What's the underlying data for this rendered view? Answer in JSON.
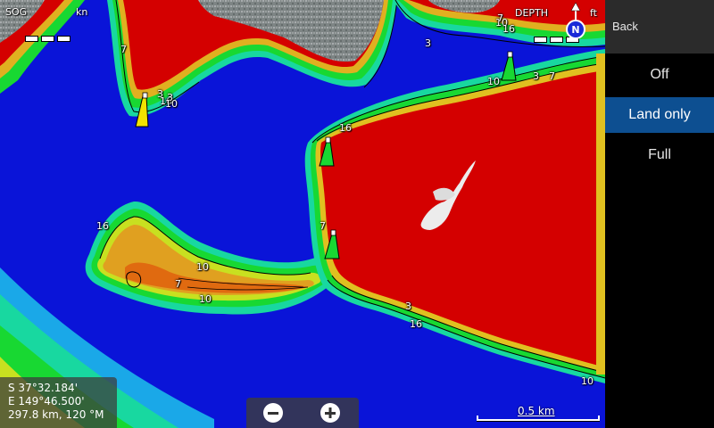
{
  "hud": {
    "sog_label": "SOG",
    "sog_unit": "kn",
    "depth_label": "DEPTH",
    "depth_unit": "ft",
    "north_label": "N"
  },
  "coordinates": {
    "lat": "S  37°32.184'",
    "lon": "E 149°46.500'",
    "range_bearing": "297.8 km, 120 °M"
  },
  "zoom": {
    "out_icon": "minus-icon",
    "in_icon": "plus-icon"
  },
  "scale": {
    "label": "0.5 km"
  },
  "depth_labels": [
    "7",
    "3",
    "16",
    "3",
    "10",
    "3",
    "7",
    "10",
    "16",
    "7",
    "3",
    "10",
    "16",
    "16",
    "7",
    "10",
    "7",
    "10",
    "3",
    "16",
    "10"
  ],
  "menu": {
    "back_label": "Back",
    "options": [
      {
        "label": "Off",
        "selected": false
      },
      {
        "label": "Land only",
        "selected": true
      },
      {
        "label": "Full",
        "selected": false
      }
    ]
  },
  "colors": {
    "deep_water": "#0a14d8",
    "land": "#d40000",
    "shallow_green": "#18d832",
    "menu_selected": "#0d4f91"
  }
}
